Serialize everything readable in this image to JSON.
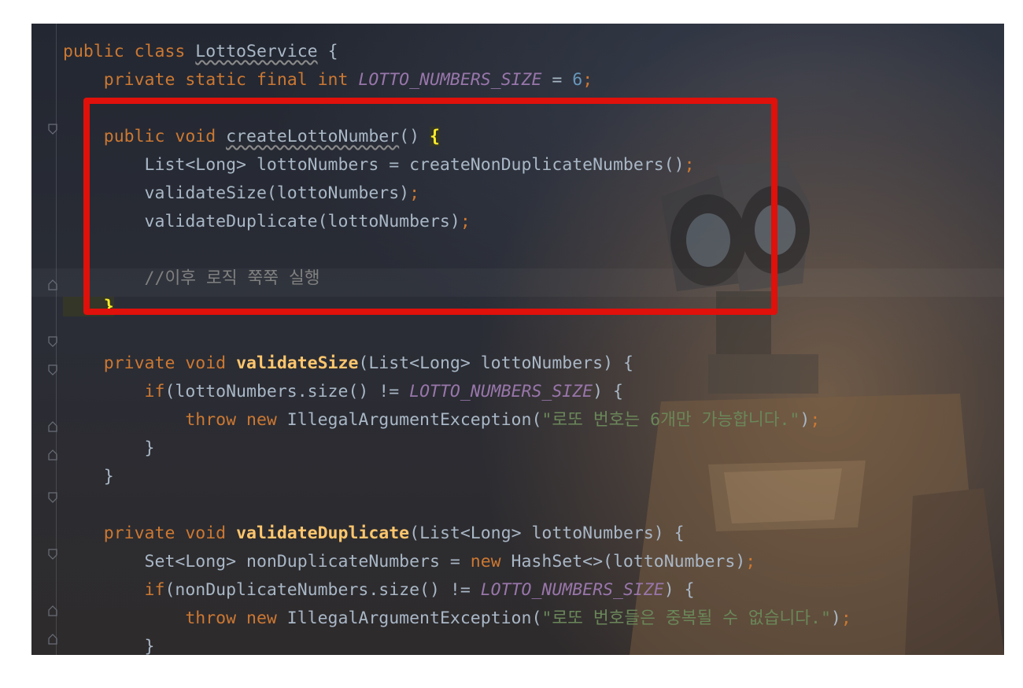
{
  "editor": {
    "lines": [
      {
        "tokens": [
          [
            "kw",
            "public class "
          ],
          [
            "plain wavy",
            "LottoService"
          ],
          [
            "plain",
            " {"
          ]
        ]
      },
      {
        "tokens": [
          [
            "kw",
            "    private static final int "
          ],
          [
            "const",
            "LOTTO_NUMBERS_SIZE"
          ],
          [
            "plain",
            " = "
          ],
          [
            "num",
            "6"
          ],
          [
            "semi",
            ";"
          ]
        ]
      },
      {
        "tokens": [
          [
            "plain",
            ""
          ]
        ]
      },
      {
        "tokens": [
          [
            "kw",
            "    public void "
          ],
          [
            "plain wavy",
            "createLottoNumber"
          ],
          [
            "plain",
            "() "
          ],
          [
            "brace-hl",
            "{"
          ]
        ]
      },
      {
        "tokens": [
          [
            "plain",
            "        List<Long> lottoNumbers = createNonDuplicateNumbers()"
          ],
          [
            "semi",
            ";"
          ]
        ]
      },
      {
        "tokens": [
          [
            "plain",
            "        validateSize(lottoNumbers)"
          ],
          [
            "semi",
            ";"
          ]
        ]
      },
      {
        "tokens": [
          [
            "plain",
            "        validateDuplicate(lottoNumbers)"
          ],
          [
            "semi",
            ";"
          ]
        ]
      },
      {
        "tokens": [
          [
            "plain",
            ""
          ]
        ]
      },
      {
        "tokens": [
          [
            "cm",
            "        //이후 로직 쭉쭉 실행"
          ]
        ]
      },
      {
        "tokens": [
          [
            "brace-hl",
            "    }"
          ]
        ]
      },
      {
        "tokens": [
          [
            "plain",
            ""
          ]
        ]
      },
      {
        "tokens": [
          [
            "kw",
            "    private void "
          ],
          [
            "fn",
            "validateSize"
          ],
          [
            "plain",
            "(List<Long> lottoNumbers) {"
          ]
        ]
      },
      {
        "tokens": [
          [
            "kw",
            "        if"
          ],
          [
            "plain",
            "(lottoNumbers.size() != "
          ],
          [
            "const",
            "LOTTO_NUMBERS_SIZE"
          ],
          [
            "plain",
            ") {"
          ]
        ]
      },
      {
        "tokens": [
          [
            "kw",
            "            throw new "
          ],
          [
            "plain",
            "IllegalArgumentException("
          ],
          [
            "str",
            "\"로또 번호는 6개만 가능합니다.\""
          ],
          [
            "plain",
            ")"
          ],
          [
            "semi",
            ";"
          ]
        ]
      },
      {
        "tokens": [
          [
            "plain",
            "        }"
          ]
        ]
      },
      {
        "tokens": [
          [
            "plain",
            "    }"
          ]
        ]
      },
      {
        "tokens": [
          [
            "plain",
            ""
          ]
        ]
      },
      {
        "tokens": [
          [
            "kw",
            "    private void "
          ],
          [
            "fn",
            "validateDuplicate"
          ],
          [
            "plain",
            "(List<Long> lottoNumbers) {"
          ]
        ]
      },
      {
        "tokens": [
          [
            "plain",
            "        Set<Long> nonDuplicateNumbers = "
          ],
          [
            "kw",
            "new "
          ],
          [
            "plain",
            "HashSet<>(lottoNumbers)"
          ],
          [
            "semi",
            ";"
          ]
        ]
      },
      {
        "tokens": [
          [
            "kw",
            "        if"
          ],
          [
            "plain",
            "(nonDuplicateNumbers.size() != "
          ],
          [
            "const",
            "LOTTO_NUMBERS_SIZE"
          ],
          [
            "plain",
            ") {"
          ]
        ]
      },
      {
        "tokens": [
          [
            "kw",
            "            throw new "
          ],
          [
            "plain",
            "IllegalArgumentException("
          ],
          [
            "str",
            "\"로또 번호들은 중복될 수 없습니다.\""
          ],
          [
            "plain",
            ")"
          ],
          [
            "semi",
            ";"
          ]
        ]
      },
      {
        "tokens": [
          [
            "plain",
            "        }"
          ]
        ]
      },
      {
        "tokens": [
          [
            "plain",
            "    }"
          ]
        ]
      }
    ]
  },
  "colors": {
    "keyword": "#cc7832",
    "number": "#6897bb",
    "constant": "#9876aa",
    "method": "#ffc66d",
    "string": "#6a8759",
    "comment": "#808080",
    "text": "#a9b7c6",
    "highlight_box": "#e0100b"
  }
}
